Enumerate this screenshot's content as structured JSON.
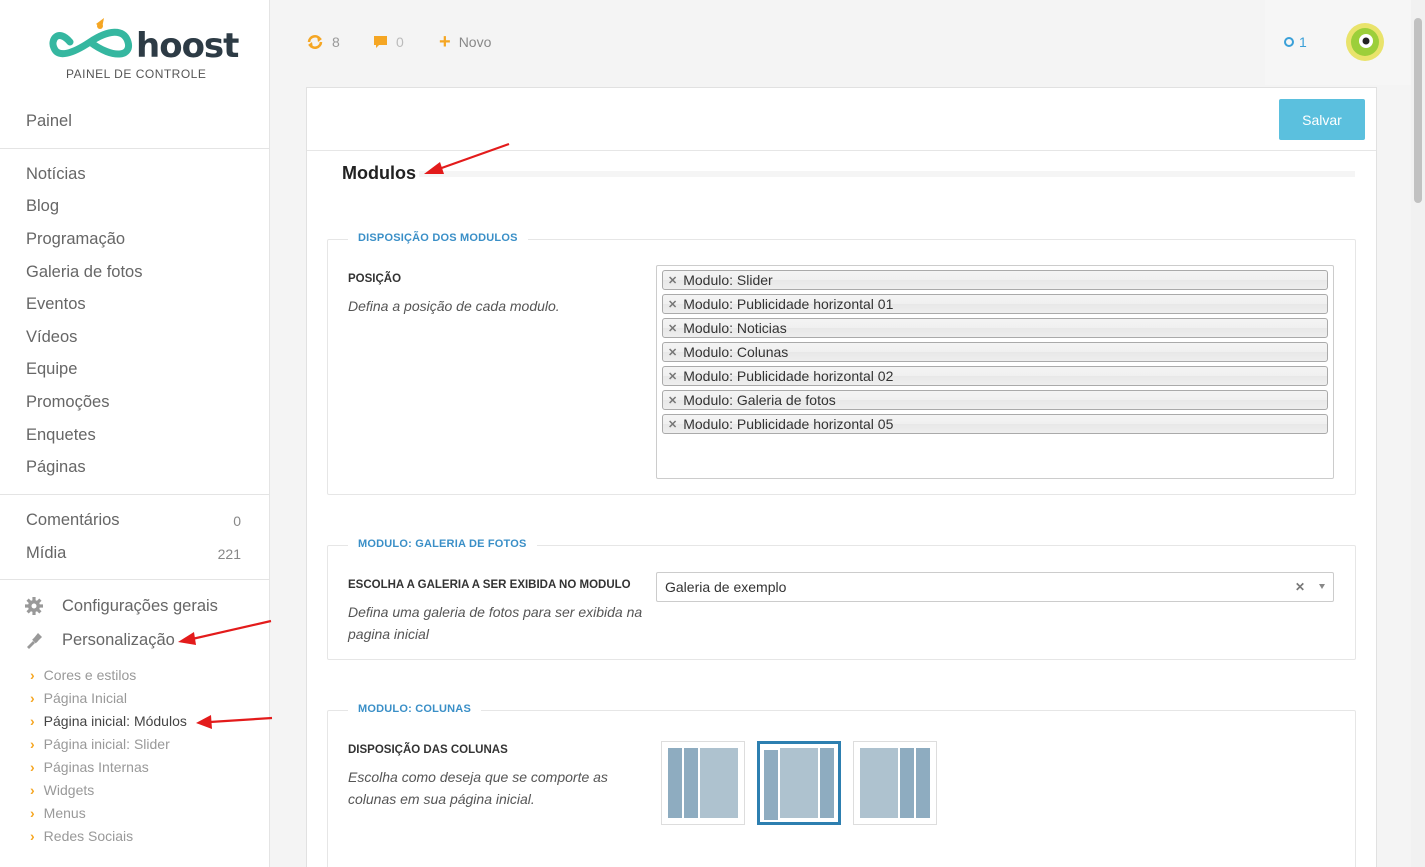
{
  "logo": {
    "brand": "hoost",
    "subtitle": "PAINEL DE CONTROLE"
  },
  "sidebar": {
    "dashboard": "Painel",
    "items": [
      "Notícias",
      "Blog",
      "Programação",
      "Galeria de fotos",
      "Eventos",
      "Vídeos",
      "Equipe",
      "Promoções",
      "Enquetes",
      "Páginas"
    ],
    "comments": {
      "label": "Comentários",
      "count": "0"
    },
    "media": {
      "label": "Mídia",
      "count": "221"
    },
    "settings": "Configurações gerais",
    "customization": "Personalização",
    "sub_items": [
      "Cores e estilos",
      "Página Inicial",
      "Página inicial: Módulos",
      "Página inicial: Slider",
      "Páginas Internas",
      "Widgets",
      "Menus",
      "Redes Sociais"
    ],
    "active_sub": "Página inicial: Módulos"
  },
  "topbar": {
    "updates": "8",
    "comments": "0",
    "new": "Novo",
    "notifications": "1"
  },
  "panel": {
    "save": "Salvar",
    "title": "Modulos",
    "sections": {
      "layout": {
        "legend": "DISPOSIÇÃO DOS MODULOS",
        "label": "POSIÇÃO",
        "desc": "Defina a posição de cada modulo.",
        "tags": [
          "Modulo: Slider",
          "Modulo: Publicidade horizontal 01",
          "Modulo: Noticias",
          "Modulo: Colunas",
          "Modulo: Publicidade horizontal 02",
          "Modulo: Galeria de fotos",
          "Modulo: Publicidade horizontal 05"
        ]
      },
      "gallery": {
        "legend": "MODULO: GALERIA DE FOTOS",
        "label": "ESCOLHA A GALERIA A SER EXIBIDA NO MODULO",
        "desc": "Defina uma galeria de fotos para ser exibida na pagina inicial",
        "selected": "Galeria de exemplo"
      },
      "columns": {
        "legend": "MODULO: COLUNAS",
        "label": "DISPOSIÇÃO DAS COLUNAS",
        "desc": "Escolha como deseja que se comporte as colunas em sua página inicial."
      }
    }
  },
  "colors": {
    "accent": "#5bc0de",
    "legend": "#3a8fc7",
    "chevron": "#f5a623",
    "arrow": "#e31b1b"
  }
}
